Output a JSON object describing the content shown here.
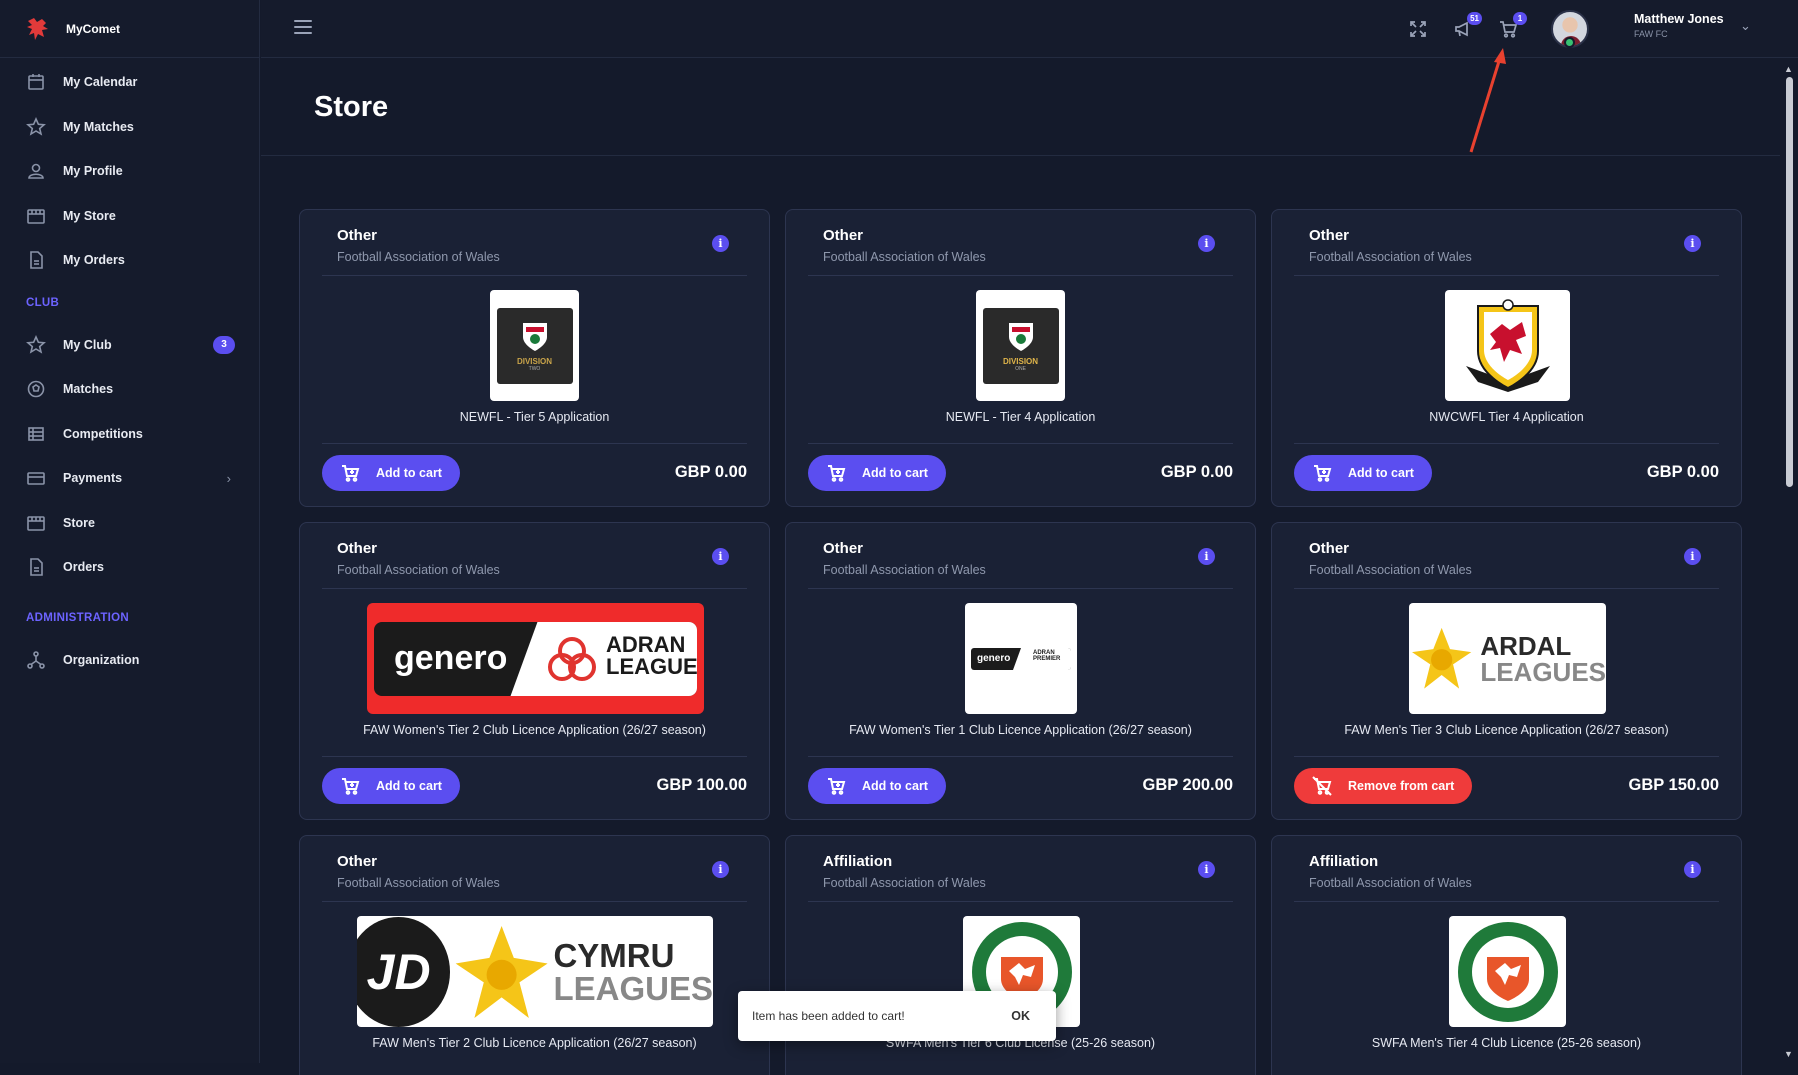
{
  "app": {
    "name": "MyComet"
  },
  "sidebar": {
    "top_items": [
      {
        "label": "My Calendar",
        "icon": "calendar-icon"
      },
      {
        "label": "My Matches",
        "icon": "star-icon"
      },
      {
        "label": "My Profile",
        "icon": "user-icon"
      },
      {
        "label": "My Store",
        "icon": "store-icon"
      },
      {
        "label": "My Orders",
        "icon": "document-icon"
      }
    ],
    "club_section": "CLUB",
    "club_items": [
      {
        "label": "My Club",
        "icon": "star-icon",
        "badge": "3"
      },
      {
        "label": "Matches",
        "icon": "ball-icon"
      },
      {
        "label": "Competitions",
        "icon": "list-icon"
      },
      {
        "label": "Payments",
        "icon": "card-icon"
      },
      {
        "label": "Store",
        "icon": "store-icon"
      },
      {
        "label": "Orders",
        "icon": "document-icon"
      }
    ],
    "admin_section": "ADMINISTRATION",
    "admin_items": [
      {
        "label": "Organization",
        "icon": "org-icon"
      }
    ]
  },
  "topbar": {
    "notifications_count": "51",
    "cart_count": "1",
    "user_name": "Matthew Jones",
    "user_club": "FAW FC"
  },
  "page": {
    "title": "Store"
  },
  "products": [
    {
      "category": "Other",
      "org": "Football Association of Wales",
      "name": "NEWFL - Tier 5 Application",
      "action": "Add to cart",
      "price": "GBP 0.00",
      "logo_text": "DIVISION",
      "logo_sub": "TWO"
    },
    {
      "category": "Other",
      "org": "Football Association of Wales",
      "name": "NEWFL - Tier 4 Application",
      "action": "Add to cart",
      "price": "GBP 0.00",
      "logo_text": "DIVISION",
      "logo_sub": "ONE"
    },
    {
      "category": "Other",
      "org": "Football Association of Wales",
      "name": "NWCWFL Tier 4 Application",
      "action": "Add to cart",
      "price": "GBP 0.00"
    },
    {
      "category": "Other",
      "org": "Football Association of Wales",
      "name": "FAW Women's Tier 2 Club Licence Application (26/27 season)",
      "action": "Add to cart",
      "price": "GBP 100.00",
      "logo_text": "genero",
      "logo_sub": "ADRAN",
      "logo_sub2": "LEAGUES"
    },
    {
      "category": "Other",
      "org": "Football Association of Wales",
      "name": "FAW Women's Tier 1 Club Licence Application (26/27 season)",
      "action": "Add to cart",
      "price": "GBP 200.00",
      "logo_text": "genero",
      "logo_sub": "ADRAN",
      "logo_sub2": "PREMIER"
    },
    {
      "category": "Other",
      "org": "Football Association of Wales",
      "name": "FAW Men's Tier 3 Club Licence Application (26/27 season)",
      "action": "Remove from cart",
      "price": "GBP 150.00",
      "logo_text": "ARDAL",
      "logo_sub": "LEAGUES"
    },
    {
      "category": "Other",
      "org": "Football Association of Wales",
      "name": "FAW Men's Tier 2 Club Licence Application (26/27 season)",
      "logo_text": "JD",
      "logo_sub": "CYMRU",
      "logo_sub2": "LEAGUES"
    },
    {
      "category": "Affiliation",
      "org": "Football Association of Wales",
      "name": "SWFA Men's Tier 6 Club License (25-26 season)"
    },
    {
      "category": "Affiliation",
      "org": "Football Association of Wales",
      "name": "SWFA Men's Tier 4 Club Licence (25-26 season)"
    }
  ],
  "toast": {
    "message": "Item has been added to cart!",
    "ok": "OK"
  },
  "colors": {
    "accent": "#5b4ef0",
    "danger": "#ef3b3b",
    "bg": "#141a2b",
    "card": "#1a2135"
  }
}
